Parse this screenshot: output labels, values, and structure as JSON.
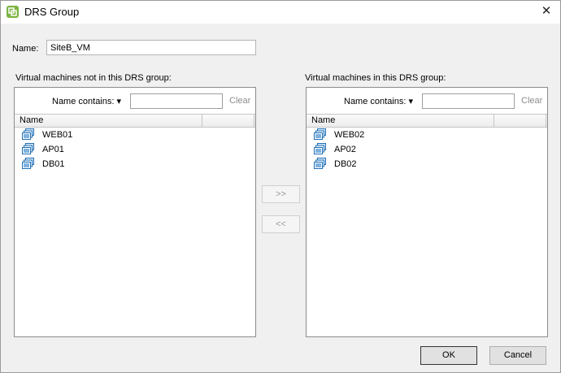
{
  "window": {
    "title": "DRS Group",
    "close_glyph": "✕"
  },
  "name_field": {
    "label": "Name:",
    "value": "SiteB_VM"
  },
  "left_panel": {
    "label": "Virtual machines not in this DRS group:",
    "filter_label": "Name contains: ▾",
    "filter_value": "",
    "clear_label": "Clear",
    "column_header": "Name",
    "items": [
      {
        "label": "WEB01",
        "icon": "vm-icon"
      },
      {
        "label": "AP01",
        "icon": "vm-icon"
      },
      {
        "label": "DB01",
        "icon": "vm-icon"
      }
    ]
  },
  "right_panel": {
    "label": "Virtual machines in this DRS group:",
    "filter_label": "Name contains: ▾",
    "filter_value": "",
    "clear_label": "Clear",
    "column_header": "Name",
    "items": [
      {
        "label": "WEB02",
        "icon": "vm-icon"
      },
      {
        "label": "AP02",
        "icon": "vm-icon"
      },
      {
        "label": "DB02",
        "icon": "vm-icon"
      }
    ]
  },
  "move_buttons": {
    "add": ">>",
    "remove": "<<"
  },
  "footer": {
    "ok": "OK",
    "cancel": "Cancel"
  },
  "colors": {
    "window_bg": "#f0f0f0",
    "icon_blue": "#1f6fb5",
    "app_icon_green": "#7cb342",
    "disabled_text": "#9a9a9a"
  }
}
